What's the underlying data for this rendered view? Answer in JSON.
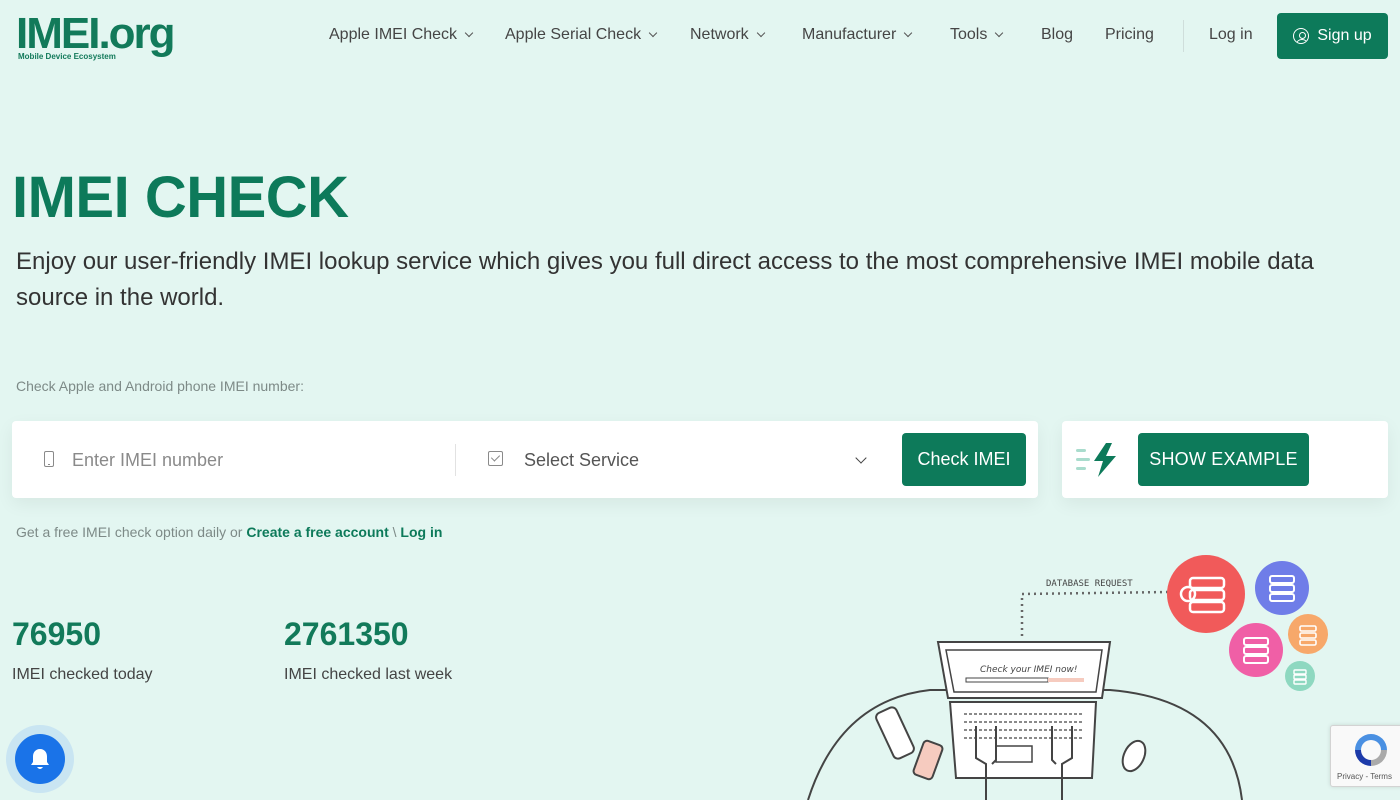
{
  "logo": {
    "main": "IMEI.org",
    "sub": "Mobile Device Ecosystem"
  },
  "nav": {
    "items": [
      {
        "label": "Apple IMEI Check",
        "dropdown": true
      },
      {
        "label": "Apple Serial Check",
        "dropdown": true
      },
      {
        "label": "Network",
        "dropdown": true
      },
      {
        "label": "Manufacturer",
        "dropdown": true
      },
      {
        "label": "Tools",
        "dropdown": true
      },
      {
        "label": "Blog",
        "dropdown": false
      },
      {
        "label": "Pricing",
        "dropdown": false
      }
    ],
    "login": "Log in",
    "signup": "Sign up"
  },
  "hero": {
    "title": "IMEI CHECK",
    "description": "Enjoy our user-friendly IMEI lookup service which gives you full direct access to the most comprehensive IMEI mobile data source in the world."
  },
  "form": {
    "label": "Check Apple and Android phone IMEI number:",
    "imei_placeholder": "Enter IMEI number",
    "imei_value": "",
    "service_selected": "Select Service",
    "check_button": "Check IMEI",
    "example_button": "SHOW EXAMPLE"
  },
  "free_note": {
    "text": "Get a free IMEI check option daily or ",
    "create_link": "Create a free account",
    "separator": " \\ ",
    "login_link": "Log in"
  },
  "stats": [
    {
      "value": "76950",
      "label": "IMEI checked today"
    },
    {
      "value": "2761350",
      "label": "IMEI checked last week"
    }
  ],
  "illustration": {
    "db_label": "DATABASE REQUEST",
    "screen_text": "Check your IMEI now!"
  },
  "recaptcha": {
    "links": "Privacy - Terms"
  },
  "colors": {
    "brand": "#0d7a5a",
    "background": "#e3f6f1",
    "bell": "#1a73e8"
  }
}
